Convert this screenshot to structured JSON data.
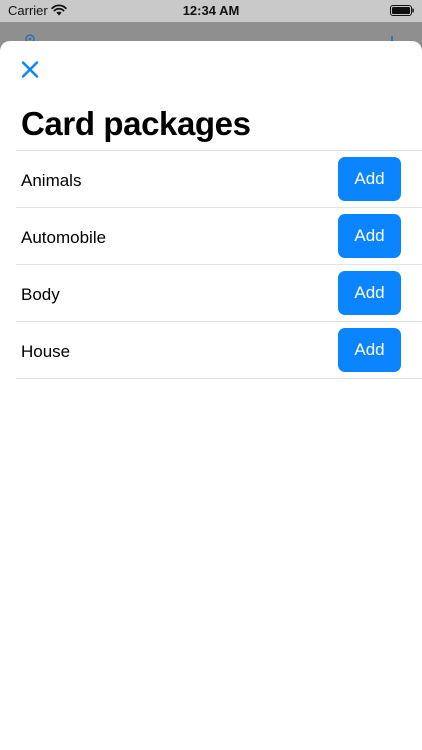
{
  "status_bar": {
    "carrier": "Carrier",
    "time": "12:34 AM",
    "wifi_icon": "wifi-icon",
    "battery_icon": "battery-icon"
  },
  "sheet": {
    "close_icon": "close-icon",
    "title": "Card packages",
    "accent_color": "#0a84ff",
    "packages": [
      {
        "name": "Animals",
        "action": "Add"
      },
      {
        "name": "Automobile",
        "action": "Add"
      },
      {
        "name": "Body",
        "action": "Add"
      },
      {
        "name": "House",
        "action": "Add"
      }
    ]
  }
}
